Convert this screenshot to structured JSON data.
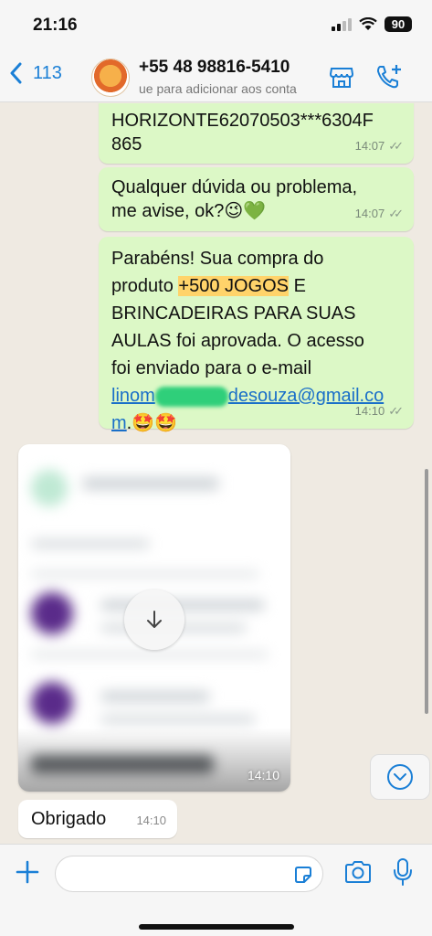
{
  "status": {
    "time": "21:16",
    "battery": "90"
  },
  "header": {
    "back_count": "113",
    "contact_name": "+55 48 98816-5410",
    "contact_sub": "ue para adicionar aos conta"
  },
  "messages": [
    {
      "lines": [
        "HORIZONTE62070503***6304F",
        "865"
      ],
      "time": "14:07"
    },
    {
      "lines": [
        "Qualquer dúvida ou problema,",
        "me avise, ok?😉💚"
      ],
      "time": "14:07"
    },
    {
      "l1": "Parabéns! Sua compra do",
      "l2_pre": "produto ",
      "l2_hl": "+500 JOGOS",
      "l2_post": " E",
      "l3": "BRINCADEIRAS PARA SUAS",
      "l4": "AULAS foi aprovada. O acesso",
      "l5": "foi enviado para o e-mail",
      "email_a": "linom",
      "email_b": "desouza@gmail.co",
      "email_c": "m",
      "emoji": ".🤩🤩",
      "time": "14:10"
    }
  ],
  "media": {
    "time": "14:10"
  },
  "incoming": {
    "text": "Obrigado",
    "time": "14:10"
  },
  "composer": {
    "placeholder": ""
  },
  "colors": {
    "accent": "#1a7fd6",
    "outgoing_bubble": "#dcf8c6",
    "highlight": "#ffd36a"
  }
}
